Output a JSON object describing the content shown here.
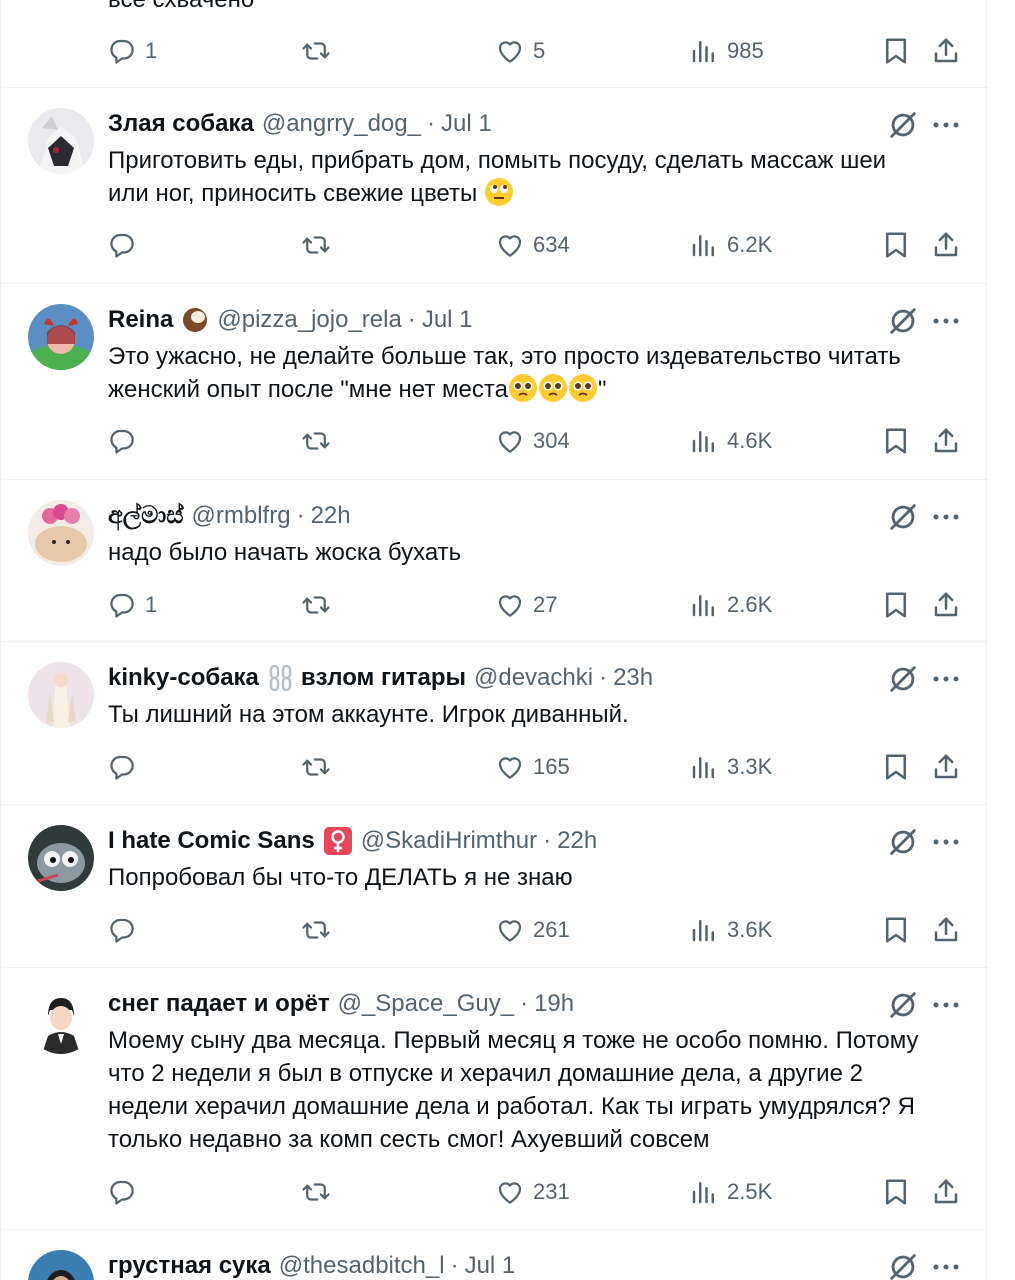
{
  "top_partial": {
    "text": "все схвачено",
    "replies": "1",
    "retweets": "",
    "likes": "5",
    "views": "985"
  },
  "posts": [
    {
      "name": "Злая собака",
      "handle": "@angrry_dog_",
      "time": "Jul 1",
      "lines": [
        "Приготовить еды, прибрать дом, помыть посуду, сделать массаж шеи",
        "или ног, приносить свежие цветы"
      ],
      "replies": "",
      "retweets": "",
      "likes": "634",
      "views": "6.2K",
      "avatar_color": "#7a2b36"
    },
    {
      "name": "Reina",
      "handle": "@pizza_jojo_rela",
      "time": "Jul 1",
      "lines": [
        "Это ужасно, не делайте больше так, это просто издевательство читать",
        "женский опыт после \"мне нет места"
      ],
      "tail": "\"",
      "replies": "",
      "retweets": "",
      "likes": "304",
      "views": "4.6K",
      "avatar_color": "#4a7ea6"
    },
    {
      "name": "අල්මාස්",
      "handle": "@rmblfrg",
      "time": "22h",
      "lines": [
        "надо было начать жоска бухать"
      ],
      "replies": "1",
      "retweets": "",
      "likes": "27",
      "views": "2.6K",
      "avatar_color": "#e6a8c7"
    },
    {
      "name": "kinky-собака",
      "name2": "взлом гитары",
      "handle": "@devachki",
      "time": "23h",
      "lines": [
        "Ты лишний на этом аккаунте. Игрок диванный."
      ],
      "replies": "",
      "retweets": "",
      "likes": "165",
      "views": "3.3K",
      "avatar_color": "#d9c7cf"
    },
    {
      "name": "I hate Comic Sans",
      "handle": "@SkadiHrimthur",
      "time": "22h",
      "lines": [
        "Попробовал бы что-то ДЕЛАТЬ я не знаю"
      ],
      "replies": "",
      "retweets": "",
      "likes": "261",
      "views": "3.6K",
      "avatar_color": "#3f4a4c"
    },
    {
      "name": "снег падает и орёт",
      "handle": "@_Space_Guy_",
      "time": "19h",
      "lines": [
        "Моему сыну два месяца. Первый месяц я тоже не особо помню. Потому",
        "что 2 недели я был в отпуске и херачил домашние дела, а другие 2",
        "недели херачил домашние дела и работал. Как ты играть умудрялся? Я",
        "только недавно за комп сесть смог! Ахуевший совсем"
      ],
      "replies": "",
      "retweets": "",
      "likes": "231",
      "views": "2.5K",
      "avatar_color": "#ffffff"
    },
    {
      "name": "грустная сука",
      "handle": "@thesadbitch_l",
      "time": "Jul 1",
      "lines": [],
      "avatar_color": "#3a7fb0"
    }
  ]
}
